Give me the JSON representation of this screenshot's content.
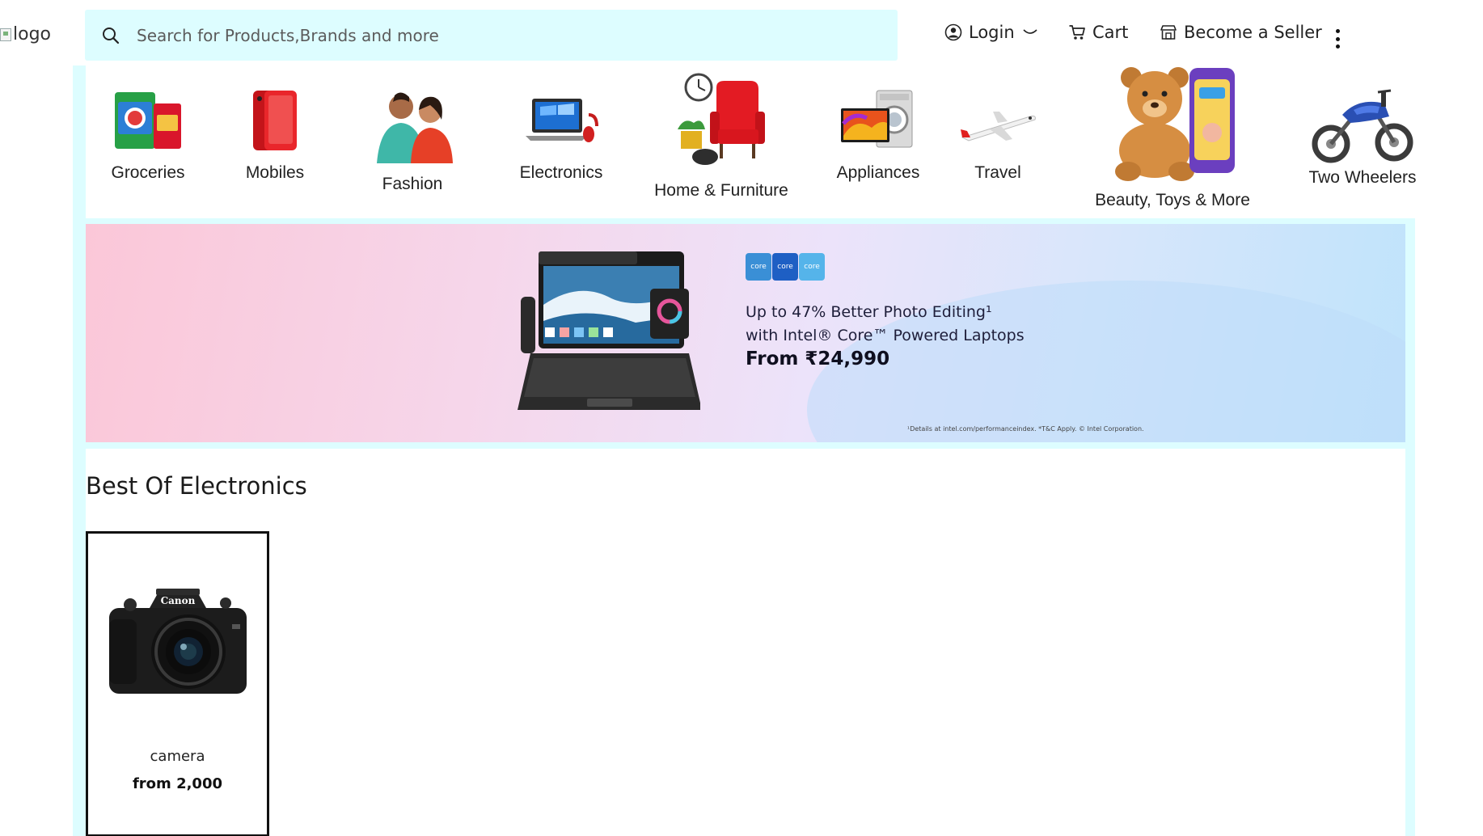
{
  "header": {
    "logo_alt": "logo",
    "search_placeholder": "Search for Products,Brands and more",
    "login_label": "Login",
    "cart_label": "Cart",
    "seller_label": "Become a Seller"
  },
  "categories": [
    {
      "label": "Groceries",
      "icon": "groceries-icon"
    },
    {
      "label": "Mobiles",
      "icon": "mobile-phone-icon"
    },
    {
      "label": "Fashion",
      "icon": "fashion-icon"
    },
    {
      "label": "Electronics",
      "icon": "laptop-icon"
    },
    {
      "label": "Home & Furniture",
      "icon": "armchair-icon"
    },
    {
      "label": "Appliances",
      "icon": "appliances-icon"
    },
    {
      "label": "Travel",
      "icon": "airplane-icon"
    },
    {
      "label": "Beauty, Toys & More",
      "icon": "teddy-bear-icon"
    },
    {
      "label": "Two Wheelers",
      "icon": "motorcycle-icon"
    }
  ],
  "banner": {
    "badges": [
      "core",
      "core",
      "core"
    ],
    "line1": "Up to 47% Better Photo Editing¹",
    "line2": "with Intel® Core™ Powered Laptops",
    "line3": "From ₹24,990",
    "fineprint": "¹Details at intel.com/performanceindex. *T&C Apply. © Intel Corporation."
  },
  "best_of_electronics": {
    "title": "Best Of Electronics",
    "products": [
      {
        "name": "camera",
        "price": "from 2,000",
        "brand_text": "Canon"
      }
    ]
  },
  "colors": {
    "panel_bg": "#ddfdff",
    "search_bg": "#ddfdff"
  }
}
